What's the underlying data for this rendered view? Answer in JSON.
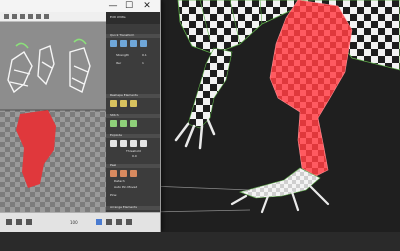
{
  "window": {
    "minimize_glyph": "—",
    "maximize_glyph": "☐",
    "close_glyph": "✕"
  },
  "panel": {
    "header": "Edit UVWs",
    "sections": [
      "Quick Transform",
      "Reshape Elements",
      "Stitch",
      "Explode",
      "Peel",
      "Arrange Elements"
    ],
    "labels": {
      "strength": "Strength",
      "iterations": "Iter",
      "threshold": "Threshold",
      "detach": "Detach",
      "auto_pin": "Auto Pin Moved",
      "pins": "Pins:"
    },
    "values": {
      "strength": "0.1",
      "iterations": "1",
      "threshold": "0.0"
    }
  },
  "status": {
    "zoom": "100"
  },
  "colors": {
    "uv_red": "#e0383c",
    "viewport_bg": "#1f1f1f",
    "panel_bg": "#3c3c3c",
    "mesh_red": "#ff4a52",
    "checker_dark": "#1e1e1e"
  }
}
